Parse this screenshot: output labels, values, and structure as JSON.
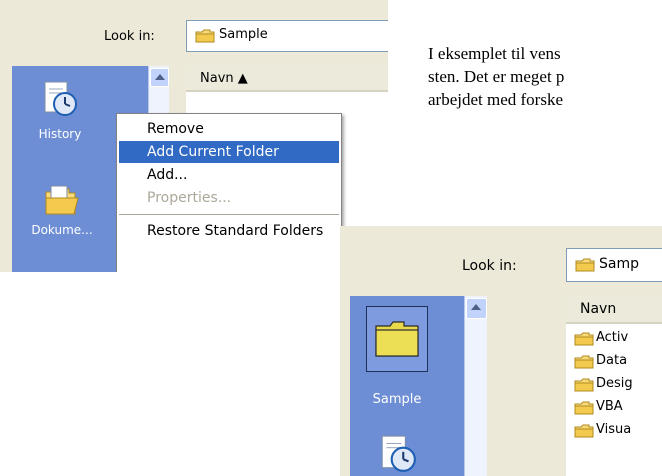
{
  "shot1": {
    "lookin_label": "Look in:",
    "lookin_underline": "i",
    "path_value": "Sample",
    "places": [
      {
        "label": "History",
        "icon": "history-clock-icon"
      },
      {
        "label": "Dokume...",
        "icon": "open-folder-icon"
      }
    ],
    "column_header": "Navn ▲",
    "context_menu": [
      {
        "label": "Remove",
        "state": "normal"
      },
      {
        "label": "Add Current Folder",
        "state": "selected"
      },
      {
        "label": "Add...",
        "state": "normal"
      },
      {
        "label": "Properties...",
        "state": "disabled"
      },
      {
        "label": "Restore Standard Folders",
        "state": "normal"
      }
    ]
  },
  "shot2": {
    "lookin_label": "Look in:",
    "path_value": "Samp",
    "places": [
      {
        "label": "Sample",
        "icon": "folder-icon"
      },
      {
        "label": "",
        "icon": "history-clock-icon"
      }
    ],
    "column_header": "Navn",
    "files": [
      "Activ",
      "Data",
      "Desig",
      "VBA",
      "Visua"
    ]
  },
  "paragraph": {
    "line1": "I eksemplet til vens",
    "line2": "sten. Det er meget p",
    "line3": "arbejdet med forske"
  },
  "colors": {
    "dialog_bg": "#ece9d8",
    "places_bg": "#6d8ed5",
    "menu_highlight": "#316ac5",
    "folder_yellow": "#f3d36b"
  }
}
